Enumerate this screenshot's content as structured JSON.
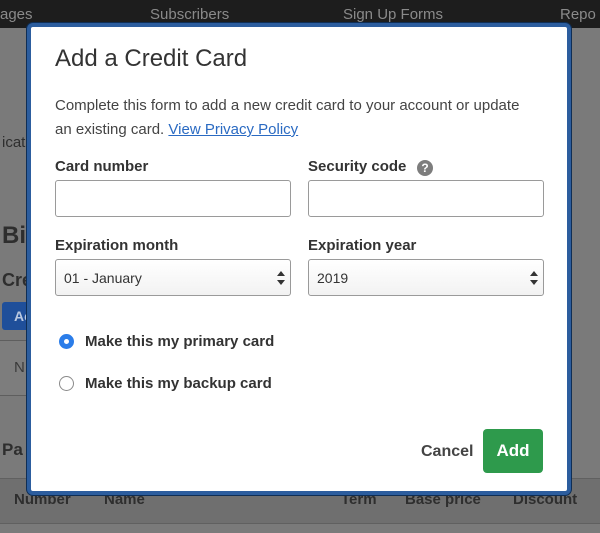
{
  "background": {
    "nav": [
      "ages",
      "Subscribers",
      "Sign Up Forms",
      "Repo"
    ],
    "fragments": {
      "left_cat": "icat",
      "heading": "Bi",
      "sub": "Cre",
      "btn": "Ac",
      "box": "N",
      "pa": "Pa"
    },
    "table_headers": [
      "Number",
      "Name",
      "Term",
      "Base price",
      "Discount"
    ]
  },
  "modal": {
    "title": "Add a Credit Card",
    "description": "Complete this form to add a new credit card to your account or update an existing card.",
    "privacy_link": "View Privacy Policy",
    "card_number_label": "Card number",
    "card_number_value": "",
    "security_code_label": "Security code",
    "security_code_value": "",
    "help_icon": "?",
    "exp_month_label": "Expiration month",
    "exp_month_value": "01 - January",
    "exp_year_label": "Expiration year",
    "exp_year_value": "2019",
    "primary_label": "Make this my primary card",
    "backup_label": "Make this my backup card",
    "cancel_label": "Cancel",
    "add_label": "Add"
  },
  "colors": {
    "modal_border": "#2c5d9e",
    "link": "#2a6ac2",
    "radio_selected": "#2b7de9",
    "add_button": "#2e9a4c"
  }
}
